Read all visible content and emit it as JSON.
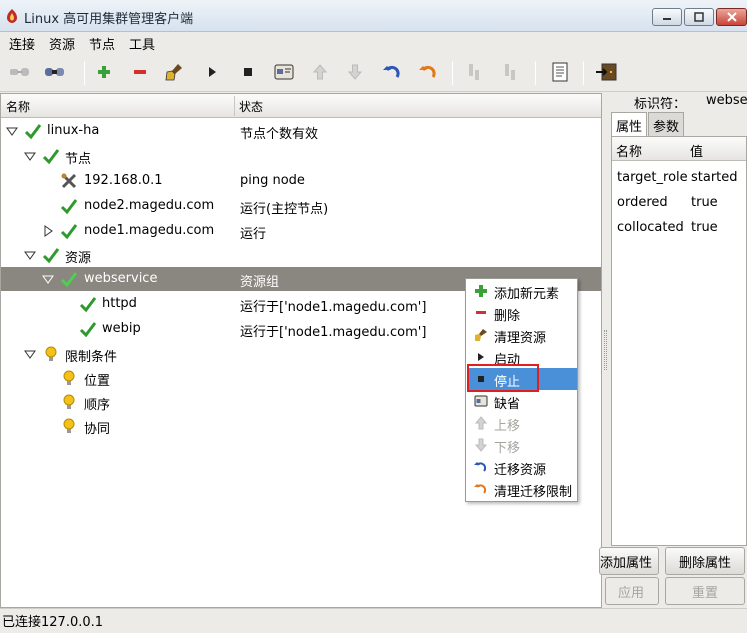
{
  "window": {
    "title": "Linux 高可用集群管理客户端"
  },
  "menubar": [
    "连接",
    "资源",
    "节点",
    "工具"
  ],
  "toolbar": {
    "icons": [
      "connect-icon",
      "disconnect-icon",
      "add-icon",
      "delete-icon",
      "cleanup-icon",
      "start-icon",
      "stop-icon",
      "default-icon",
      "up-icon",
      "down-icon",
      "migrate-icon",
      "unmigrate-icon",
      "standby-icon",
      "active-icon",
      "log-icon",
      "exit-icon"
    ]
  },
  "tree": {
    "headers": {
      "name": "名称",
      "status": "状态"
    },
    "rows": [
      {
        "label": "linux-ha",
        "status": "节点个数有效"
      },
      {
        "label": "节点",
        "status": ""
      },
      {
        "label": "192.168.0.1",
        "status": "ping node"
      },
      {
        "label": "node2.magedu.com",
        "status": "运行(主控节点)"
      },
      {
        "label": "node1.magedu.com",
        "status": "运行"
      },
      {
        "label": "资源",
        "status": ""
      },
      {
        "label": "webservice",
        "status": "资源组"
      },
      {
        "label": "httpd",
        "status": "运行于['node1.magedu.com']"
      },
      {
        "label": "webip",
        "status": "运行于['node1.magedu.com']"
      },
      {
        "label": "限制条件",
        "status": ""
      },
      {
        "label": "位置",
        "status": ""
      },
      {
        "label": "顺序",
        "status": ""
      },
      {
        "label": "协同",
        "status": ""
      }
    ]
  },
  "context_menu": {
    "items": [
      {
        "label": "添加新元素",
        "enabled": true
      },
      {
        "label": "删除",
        "enabled": true
      },
      {
        "label": "清理资源",
        "enabled": true
      },
      {
        "label": "启动",
        "enabled": true
      },
      {
        "label": "停止",
        "enabled": true,
        "highlighted": true
      },
      {
        "label": "缺省",
        "enabled": true
      },
      {
        "label": "上移",
        "enabled": false
      },
      {
        "label": "下移",
        "enabled": false
      },
      {
        "label": "迁移资源",
        "enabled": true
      },
      {
        "label": "清理迁移限制",
        "enabled": true
      }
    ]
  },
  "right_panel": {
    "id_label": "标识符：",
    "id_value": "webse",
    "tabs": [
      "属性",
      "参数"
    ],
    "table_headers": {
      "name": "名称",
      "value": "值"
    },
    "rows": [
      {
        "name": "target_role",
        "value": "started"
      },
      {
        "name": "ordered",
        "value": "true"
      },
      {
        "name": "collocated",
        "value": "true"
      }
    ],
    "buttons": {
      "add_attr": "添加属性",
      "del_attr": "删除属性",
      "apply": "应用",
      "reset": "重置"
    }
  },
  "status_bar": {
    "text": "已连接127.0.0.1"
  },
  "colors": {
    "selection": "#8a8680",
    "menu_highlight": "#4a90d9",
    "annotation_box": "#e02020",
    "check_green": "#2e9a2e"
  }
}
